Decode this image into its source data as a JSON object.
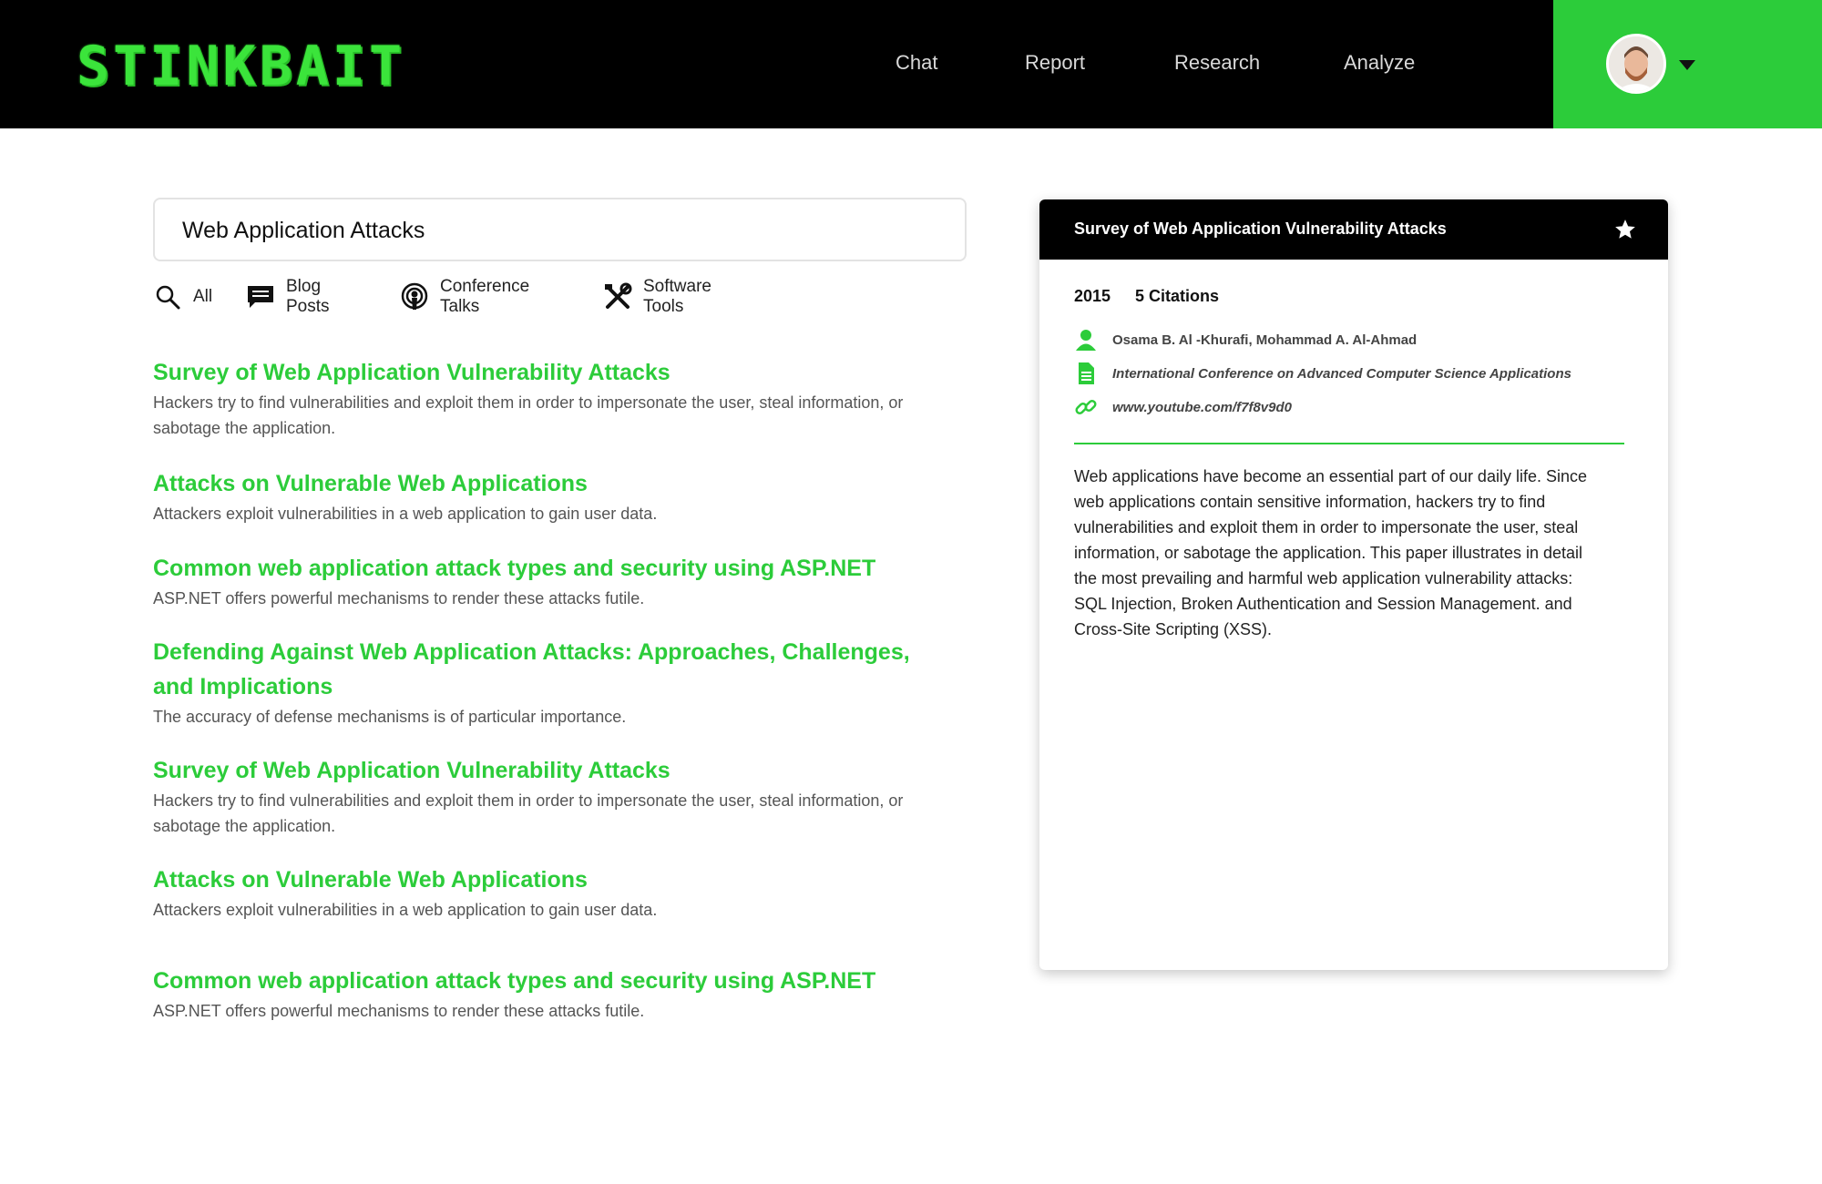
{
  "header": {
    "logo": "STINKBAIT",
    "nav": [
      "Chat",
      "Report",
      "Research",
      "Analyze"
    ]
  },
  "search": {
    "value": "Web Application Attacks"
  },
  "filters": [
    {
      "label": "All",
      "icon": "search-icon"
    },
    {
      "label": "Blog Posts",
      "icon": "chat-icon"
    },
    {
      "label": "Conference Talks",
      "icon": "podcast-icon"
    },
    {
      "label": "Software Tools",
      "icon": "tools-icon"
    }
  ],
  "results": [
    {
      "title": "Survey of Web Application Vulnerability Attacks",
      "desc_lines": [
        "Hackers try to find vulnerabilities and exploit them in order to impersonate the user, steal information, or",
        " sabotage the application."
      ]
    },
    {
      "title": "Attacks on Vulnerable Web Applications",
      "desc_lines": [
        "Attackers exploit vulnerabilities in a web application to gain user data."
      ]
    },
    {
      "title": "Common web application attack types and security using ASP.NET",
      "desc_lines": [
        "ASP.NET offers powerful mechanisms to render these attacks futile."
      ]
    },
    {
      "title_lines": [
        "Defending Against Web Application Attacks: Approaches, Challenges,",
        "and Implications"
      ],
      "desc_lines": [
        "The accuracy of defense mechanisms is of particular importance."
      ]
    },
    {
      "title": "Survey of Web Application Vulnerability Attacks",
      "desc_lines": [
        "Hackers try to find vulnerabilities and exploit them in order to impersonate the user, steal information, or",
        " sabotage the application."
      ]
    },
    {
      "title": "Attacks on Vulnerable Web Applications",
      "desc_lines": [
        "Attackers exploit vulnerabilities in a web application to gain user data."
      ]
    },
    {
      "title": "Common web application attack types and security using ASP.NET",
      "desc_lines": [
        "ASP.NET offers powerful mechanisms to render these attacks futile."
      ]
    }
  ],
  "detail": {
    "title": "Survey of Web Application Vulnerability Attacks",
    "year": "2015",
    "citations": "5 Citations",
    "authors": "Osama B. Al -Khurafi, Mohammad A. Al-Ahmad",
    "venue": "International Conference on Advanced Computer Science Applications",
    "link": "www.youtube.com/f7f8v9d0",
    "abstract_lines": [
      "Web applications have become an essential part of our daily life. Since",
      "web applications contain sensitive information, hackers try to find",
      "vulnerabilities and exploit them in order to impersonate the user, steal",
      "information, or sabotage the application. This paper illustrates in detail",
      "the most prevailing and harmful web application vulnerability attacks:",
      "SQL Injection, Broken Authentication and Session Management. and",
      "Cross-Site Scripting (XSS)."
    ]
  },
  "colors": {
    "accent": "#2ccc3a",
    "header_bg": "#000000"
  }
}
